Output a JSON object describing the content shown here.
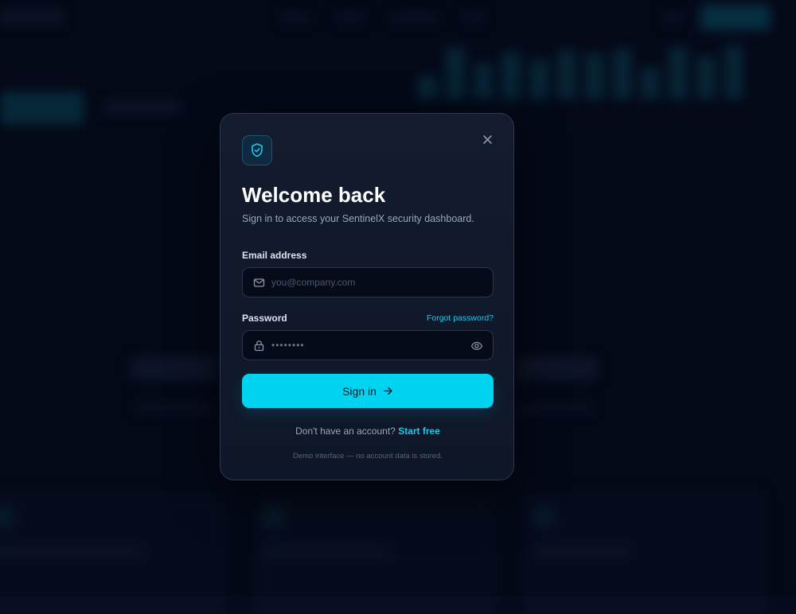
{
  "modal": {
    "title": "Welcome back",
    "subtitle": "Sign in to access your SentinelX security dashboard.",
    "logo_icon": "shield-check-icon",
    "close_icon": "close-icon"
  },
  "form": {
    "email": {
      "label": "Email address",
      "placeholder": "you@company.com",
      "value": "",
      "icon": "mail-icon"
    },
    "password": {
      "label": "Password",
      "value": "••••••••",
      "icon": "lock-icon",
      "toggle_icon": "eye-icon",
      "forgot_label": "Forgot password?"
    },
    "submit_label": "Sign in",
    "submit_icon": "arrow-right-icon"
  },
  "footer": {
    "signup_prompt": "Don't have an account?",
    "signup_link": "Start free",
    "disclaimer": "Demo interface — no account data is stored."
  },
  "colors": {
    "accent": "#00d4f0",
    "link": "#22c7e8",
    "background": "#050b1c",
    "modal": "#121c2e"
  }
}
